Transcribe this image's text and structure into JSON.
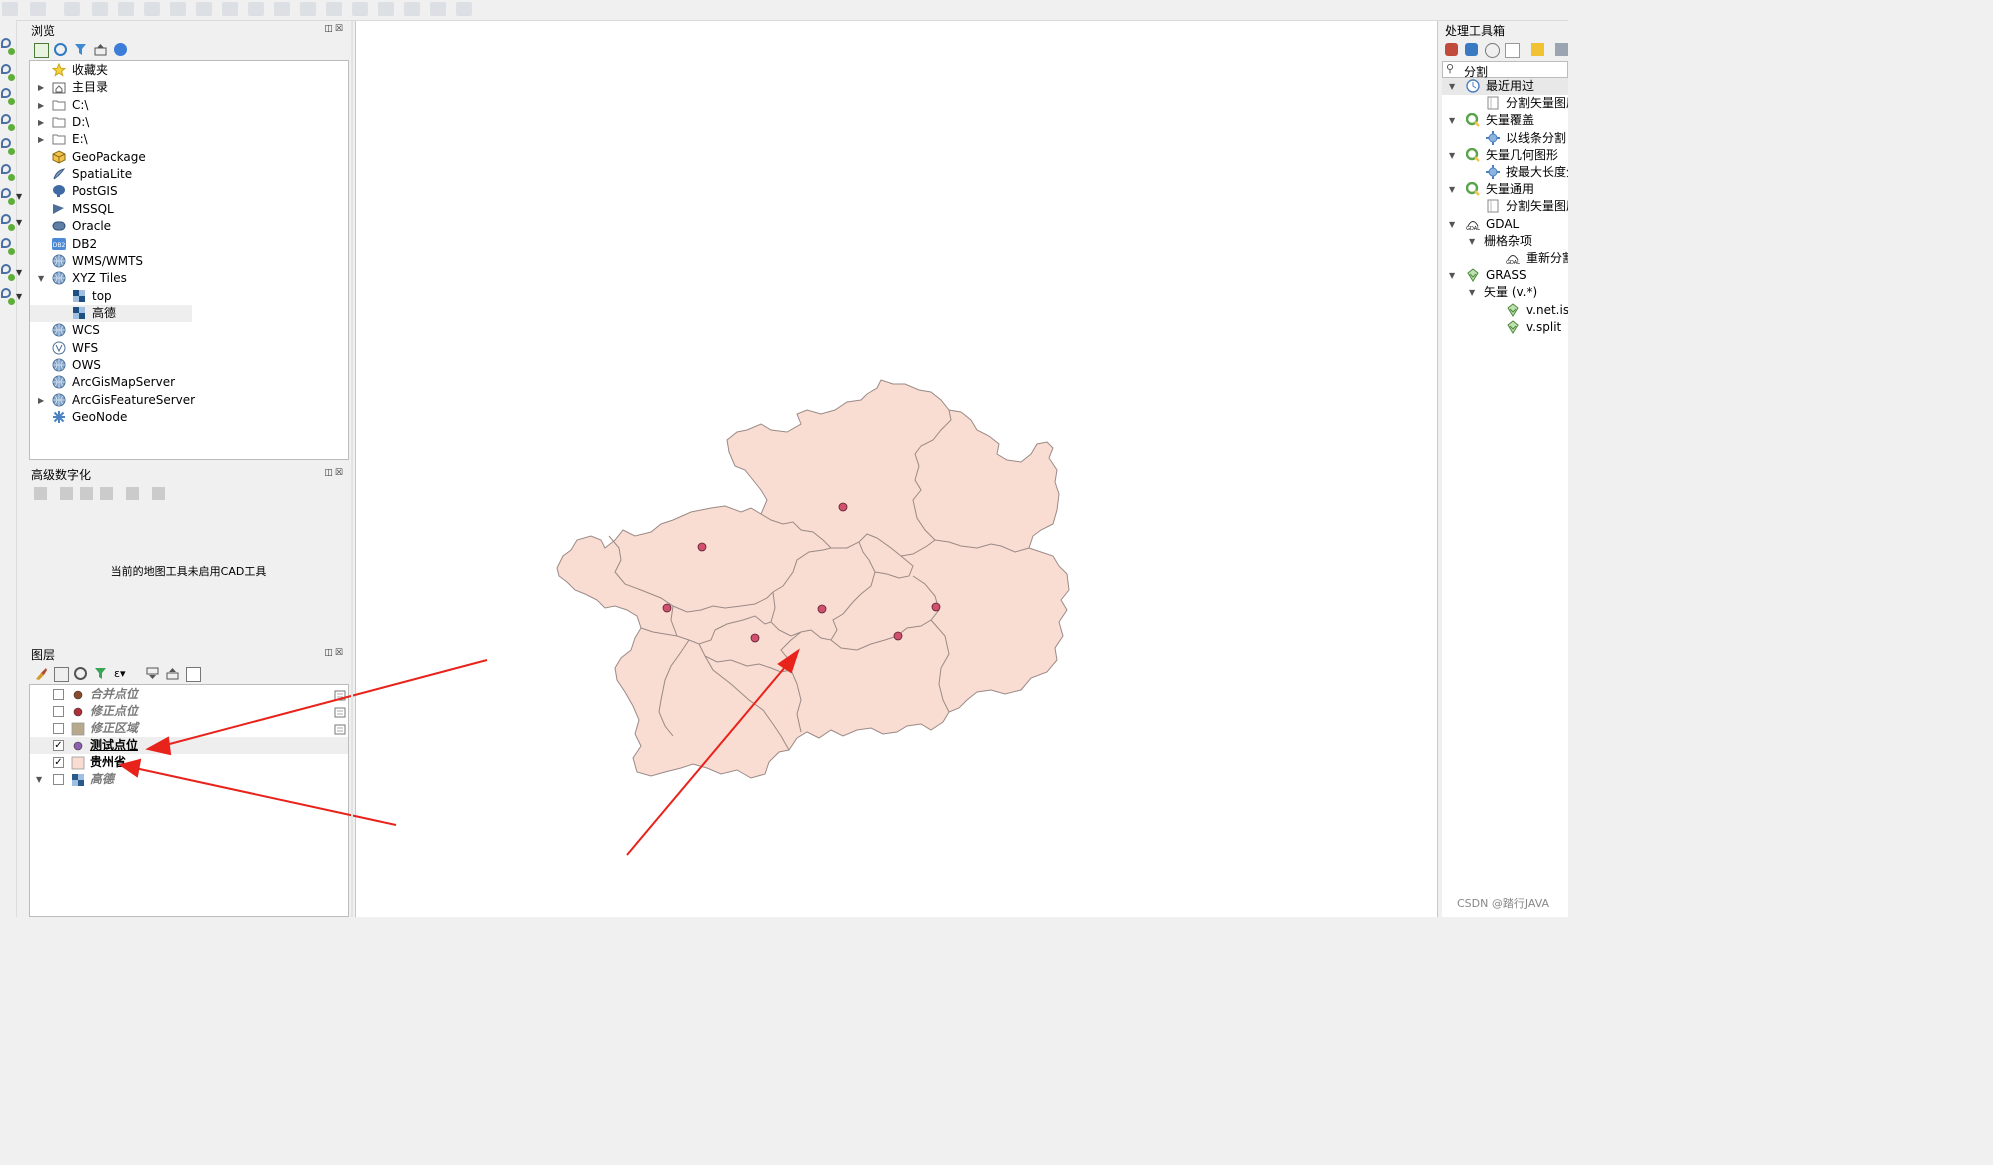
{
  "browser": {
    "title": "浏览",
    "items": [
      {
        "label": "收藏夹",
        "icon": "star-icon",
        "expandable": false
      },
      {
        "label": "主目录",
        "icon": "home-folder-icon",
        "expandable": true
      },
      {
        "label": "C:\\",
        "icon": "folder-icon",
        "expandable": true
      },
      {
        "label": "D:\\",
        "icon": "folder-icon",
        "expandable": true
      },
      {
        "label": "E:\\",
        "icon": "folder-icon",
        "expandable": true
      },
      {
        "label": "GeoPackage",
        "icon": "geopackage-icon",
        "expandable": false
      },
      {
        "label": "SpatiaLite",
        "icon": "spatialite-icon",
        "expandable": false
      },
      {
        "label": "PostGIS",
        "icon": "postgis-icon",
        "expandable": false
      },
      {
        "label": "MSSQL",
        "icon": "mssql-icon",
        "expandable": false
      },
      {
        "label": "Oracle",
        "icon": "oracle-icon",
        "expandable": false
      },
      {
        "label": "DB2",
        "icon": "db2-icon",
        "expandable": false
      },
      {
        "label": "WMS/WMTS",
        "icon": "globe-icon",
        "expandable": false
      },
      {
        "label": "XYZ Tiles",
        "icon": "globe-icon",
        "expandable": true,
        "expanded": true
      },
      {
        "label": "top",
        "icon": "tiles-icon",
        "expandable": false,
        "child": true
      },
      {
        "label": "高德",
        "icon": "tiles-icon",
        "expandable": false,
        "child": true,
        "selected": true
      },
      {
        "label": "WCS",
        "icon": "globe-icon",
        "expandable": false
      },
      {
        "label": "WFS",
        "icon": "wfs-icon",
        "expandable": false
      },
      {
        "label": "OWS",
        "icon": "globe-icon",
        "expandable": false
      },
      {
        "label": "ArcGisMapServer",
        "icon": "globe-icon",
        "expandable": false
      },
      {
        "label": "ArcGisFeatureServer",
        "icon": "globe-icon",
        "expandable": true
      },
      {
        "label": "GeoNode",
        "icon": "geonode-icon",
        "expandable": false
      }
    ]
  },
  "advdigit": {
    "title": "高级数字化",
    "message": "当前的地图工具未启用CAD工具"
  },
  "layers": {
    "title": "图层",
    "items": [
      {
        "label": "合并点位",
        "checked": false,
        "style": "italic",
        "symbol": "dot",
        "color": "#8b4a2b"
      },
      {
        "label": "修正点位",
        "checked": false,
        "style": "italic",
        "symbol": "dot",
        "color": "#b0303a"
      },
      {
        "label": "修正区域",
        "checked": false,
        "style": "italic",
        "symbol": "square",
        "color": "#b9a98c"
      },
      {
        "label": "测试点位",
        "checked": true,
        "style": "bold-underline",
        "symbol": "dot",
        "color": "#8e5fb0"
      },
      {
        "label": "贵州省",
        "checked": true,
        "style": "bold",
        "symbol": "square",
        "color": "#f9dcd2"
      },
      {
        "label": "高德",
        "checked": false,
        "style": "italic",
        "symbol": "tiles",
        "color": "#2a5a8a",
        "expandable": true
      }
    ]
  },
  "toolbox": {
    "title": "处理工具箱",
    "search_value": "分割",
    "items": [
      {
        "label": "最近用过",
        "level": 0,
        "icon": "clock-icon",
        "expandable": true
      },
      {
        "label": "分割矢量图层",
        "level": 1,
        "icon": "script-icon"
      },
      {
        "label": "矢量覆盖",
        "level": 0,
        "icon": "qgis-icon",
        "expandable": true
      },
      {
        "label": "以线条分割",
        "level": 1,
        "icon": "gear-icon"
      },
      {
        "label": "矢量几何图形",
        "level": 0,
        "icon": "qgis-icon",
        "expandable": true
      },
      {
        "label": "按最大长度分割",
        "level": 1,
        "icon": "gear-icon"
      },
      {
        "label": "矢量通用",
        "level": 0,
        "icon": "qgis-icon",
        "expandable": true
      },
      {
        "label": "分割矢量图层",
        "level": 1,
        "icon": "script-icon"
      },
      {
        "label": "GDAL",
        "level": 0,
        "icon": "gdal-icon",
        "expandable": true
      },
      {
        "label": "栅格杂项",
        "level": 1,
        "icon": "",
        "expandable": true
      },
      {
        "label": "重新分割",
        "level": 2,
        "icon": "gdal-icon"
      },
      {
        "label": "GRASS",
        "level": 0,
        "icon": "grass-icon",
        "expandable": true
      },
      {
        "label": "矢量 (v.*)",
        "level": 1,
        "icon": "",
        "expandable": true
      },
      {
        "label": "v.net.iso",
        "level": 2,
        "icon": "grass-icon"
      },
      {
        "label": "v.split",
        "level": 2,
        "icon": "grass-icon"
      }
    ]
  },
  "watermark": "CSDN @踏行JAVA",
  "colors": {
    "province_fill": "#f9dcd2",
    "province_stroke": "#9a8a86",
    "point_fill": "#d0506e",
    "arrow": "#e8231b"
  }
}
